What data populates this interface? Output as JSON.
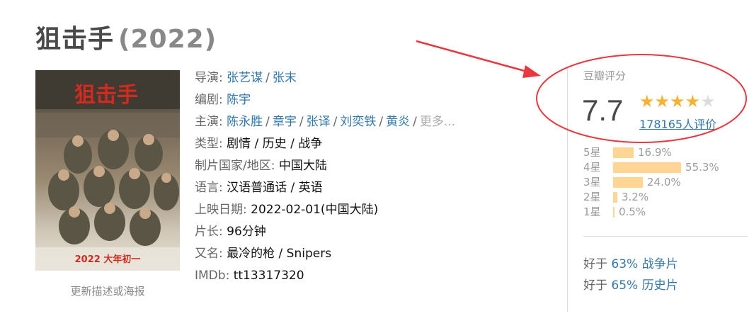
{
  "movie": {
    "title": "狙击手",
    "year": "(2022)"
  },
  "poster": {
    "caption_title": "狙击手",
    "bottom_text": "2022 大年初一",
    "update_link": "更新描述或海报"
  },
  "info": {
    "director_label": "导演:",
    "directors": [
      "张艺谋",
      "张末"
    ],
    "writer_label": "编剧:",
    "writers": [
      "陈宇"
    ],
    "cast_label": "主演:",
    "cast": [
      "陈永胜",
      "章宇",
      "张译",
      "刘奕铁",
      "黄炎"
    ],
    "cast_more": "更多...",
    "genre_label": "类型:",
    "genre_value": "剧情 / 历史 / 战争",
    "country_label": "制片国家/地区:",
    "country_value": "中国大陆",
    "language_label": "语言:",
    "language_value": "汉语普通话 / 英语",
    "release_label": "上映日期:",
    "release_value": "2022-02-01(中国大陆)",
    "runtime_label": "片长:",
    "runtime_value": "96分钟",
    "aka_label": "又名:",
    "aka_value": "最冷的枪 / Snipers",
    "imdb_label": "IMDb:",
    "imdb_value": "tt13317320"
  },
  "rating": {
    "header": "豆瓣评分",
    "score": "7.7",
    "stars_filled": 4,
    "stars_total": 5,
    "votes": "178165人评价",
    "distribution": [
      {
        "label": "5星",
        "percent": "16.9%",
        "value": 16.9
      },
      {
        "label": "4星",
        "percent": "55.3%",
        "value": 55.3
      },
      {
        "label": "3星",
        "percent": "24.0%",
        "value": 24.0
      },
      {
        "label": "2星",
        "percent": "3.2%",
        "value": 3.2
      },
      {
        "label": "1星",
        "percent": "0.5%",
        "value": 0.5
      }
    ],
    "better_than": [
      {
        "prefix": "好于",
        "pct": "63%",
        "genre": "战争片"
      },
      {
        "prefix": "好于",
        "pct": "65%",
        "genre": "历史片"
      }
    ]
  },
  "colors": {
    "link": "#3377aa",
    "star": "#f6b236",
    "bar": "#ffd596",
    "annotation": "#e8383d"
  }
}
